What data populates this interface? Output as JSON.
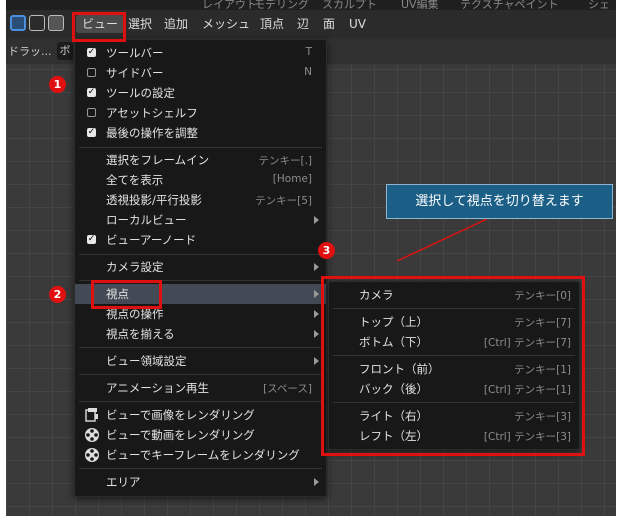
{
  "top_tabs": [
    "レイアウト",
    "モデリング",
    "スカルプト",
    "UV編集",
    "テクスチャペイント",
    "シェ"
  ],
  "header": {
    "menus": [
      "ビュー",
      "選択",
      "追加",
      "メッシュ",
      "頂点",
      "辺",
      "面",
      "UV"
    ]
  },
  "subbar": {
    "drag_label": "ドラッ...",
    "pivot_label": "ボ"
  },
  "view_menu": {
    "items": [
      {
        "label": "ツールバー",
        "shortcut": "T",
        "check": "on"
      },
      {
        "label": "サイドバー",
        "shortcut": "N",
        "check": "off"
      },
      {
        "label": "ツールの設定",
        "shortcut": "",
        "check": "on"
      },
      {
        "label": "アセットシェルフ",
        "shortcut": "",
        "check": "off"
      },
      {
        "label": "最後の操作を調整",
        "shortcut": "",
        "check": "on"
      },
      {
        "label": "選択をフレームイン",
        "shortcut": "テンキー[.]"
      },
      {
        "label": "全てを表示",
        "shortcut": "[Home]"
      },
      {
        "label": "透視投影/平行投影",
        "shortcut": "テンキー[5]"
      },
      {
        "label": "ローカルビュー",
        "submenu": true
      },
      {
        "label": "ビューアーノード",
        "check": "on"
      },
      {
        "label": "カメラ設定",
        "submenu": true
      },
      {
        "label": "視点",
        "submenu": true
      },
      {
        "label": "視点の操作",
        "submenu": true
      },
      {
        "label": "視点を揃える",
        "submenu": true
      },
      {
        "label": "ビュー領域設定",
        "submenu": true
      },
      {
        "label": "アニメーション再生",
        "shortcut": "[スペース]"
      },
      {
        "label": "ビューで画像をレンダリング",
        "icon": "render-image-icon"
      },
      {
        "label": "ビューで動画をレンダリング",
        "icon": "film-reel-icon"
      },
      {
        "label": "ビューでキーフレームをレンダリング",
        "icon": "film-reel-icon"
      },
      {
        "label": "エリア",
        "submenu": true
      }
    ]
  },
  "viewpoint_submenu": {
    "items": [
      {
        "label": "カメラ",
        "shortcut": "テンキー[0]"
      },
      {
        "label": "トップ（上）",
        "shortcut": "テンキー[7]"
      },
      {
        "label": "ボトム（下）",
        "shortcut": "[Ctrl] テンキー[7]"
      },
      {
        "label": "フロント（前）",
        "shortcut": "テンキー[1]"
      },
      {
        "label": "バック（後）",
        "shortcut": "[Ctrl] テンキー[1]"
      },
      {
        "label": "ライト（右）",
        "shortcut": "テンキー[3]"
      },
      {
        "label": "レフト（左）",
        "shortcut": "[Ctrl] テンキー[3]"
      }
    ]
  },
  "annotations": {
    "badges": [
      "1",
      "2",
      "3"
    ],
    "callout_text": "選択して視点を切り替えます",
    "accent_color": "#e01010",
    "callout_color": "#1b5e86"
  }
}
